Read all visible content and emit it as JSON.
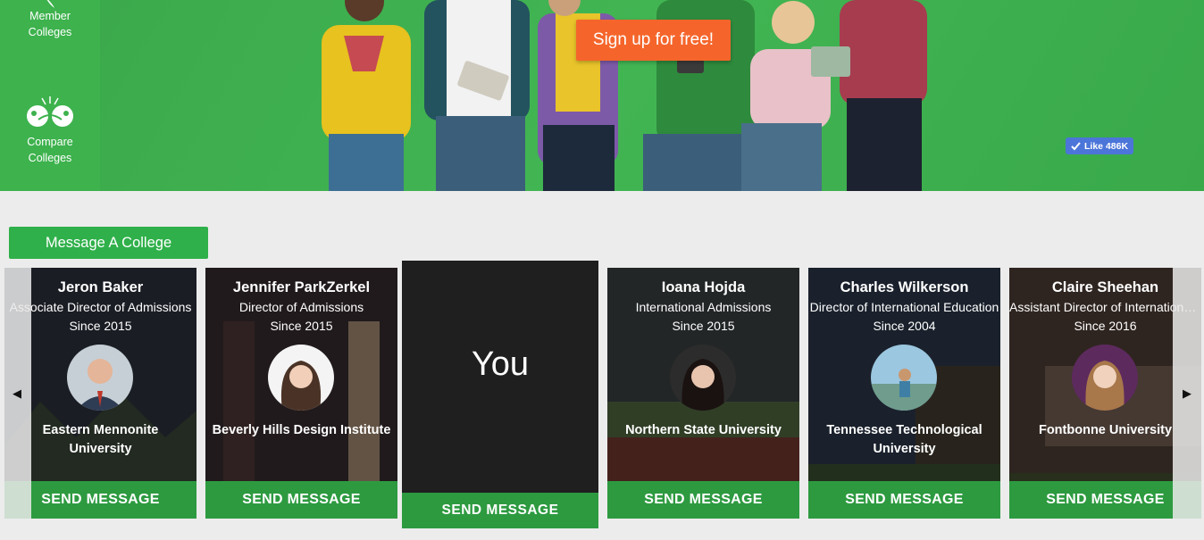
{
  "sidebar": {
    "items": [
      {
        "label_line1": "Member",
        "label_line2": "Colleges",
        "icon": "member-colleges-icon"
      },
      {
        "label_line1": "Compare",
        "label_line2": "Colleges",
        "icon": "compare-colleges-icon"
      }
    ]
  },
  "hero": {
    "signup_label": "Sign up for free!",
    "fb_like_label": "Like 486K"
  },
  "message_college_label": "Message A College",
  "carousel": {
    "prev_arrow": "◀",
    "next_arrow": "▶",
    "you_label": "You",
    "you_send_label": "SEND MESSAGE",
    "cards": [
      {
        "name": "Jeron Baker",
        "role": "Associate Director of Admissions",
        "since": "Since 2015",
        "school": "Eastern Mennonite University",
        "send_label": "SEND MESSAGE"
      },
      {
        "name": "Jennifer ParkZerkel",
        "role": "Director of Admissions",
        "since": "Since 2015",
        "school": "Beverly Hills Design Institute",
        "send_label": "SEND MESSAGE"
      },
      {
        "name": "Ioana Hojda",
        "role": "International Admissions",
        "since": "Since 2015",
        "school": "Northern State University",
        "send_label": "SEND MESSAGE"
      },
      {
        "name": "Charles Wilkerson",
        "role": "Director of International Education",
        "since": "Since 2004",
        "school": "Tennessee Technological University",
        "send_label": "SEND MESSAGE"
      },
      {
        "name": "Claire Sheehan",
        "role": "Assistant Director of International Admissions",
        "since": "Since 2016",
        "school": "Fontbonne University",
        "send_label": "SEND MESSAGE"
      }
    ]
  },
  "colors": {
    "brand_green": "#2fb04a",
    "send_green": "#2d9a40",
    "signup_orange": "#f5652b",
    "fb_blue": "#4c75d9"
  }
}
